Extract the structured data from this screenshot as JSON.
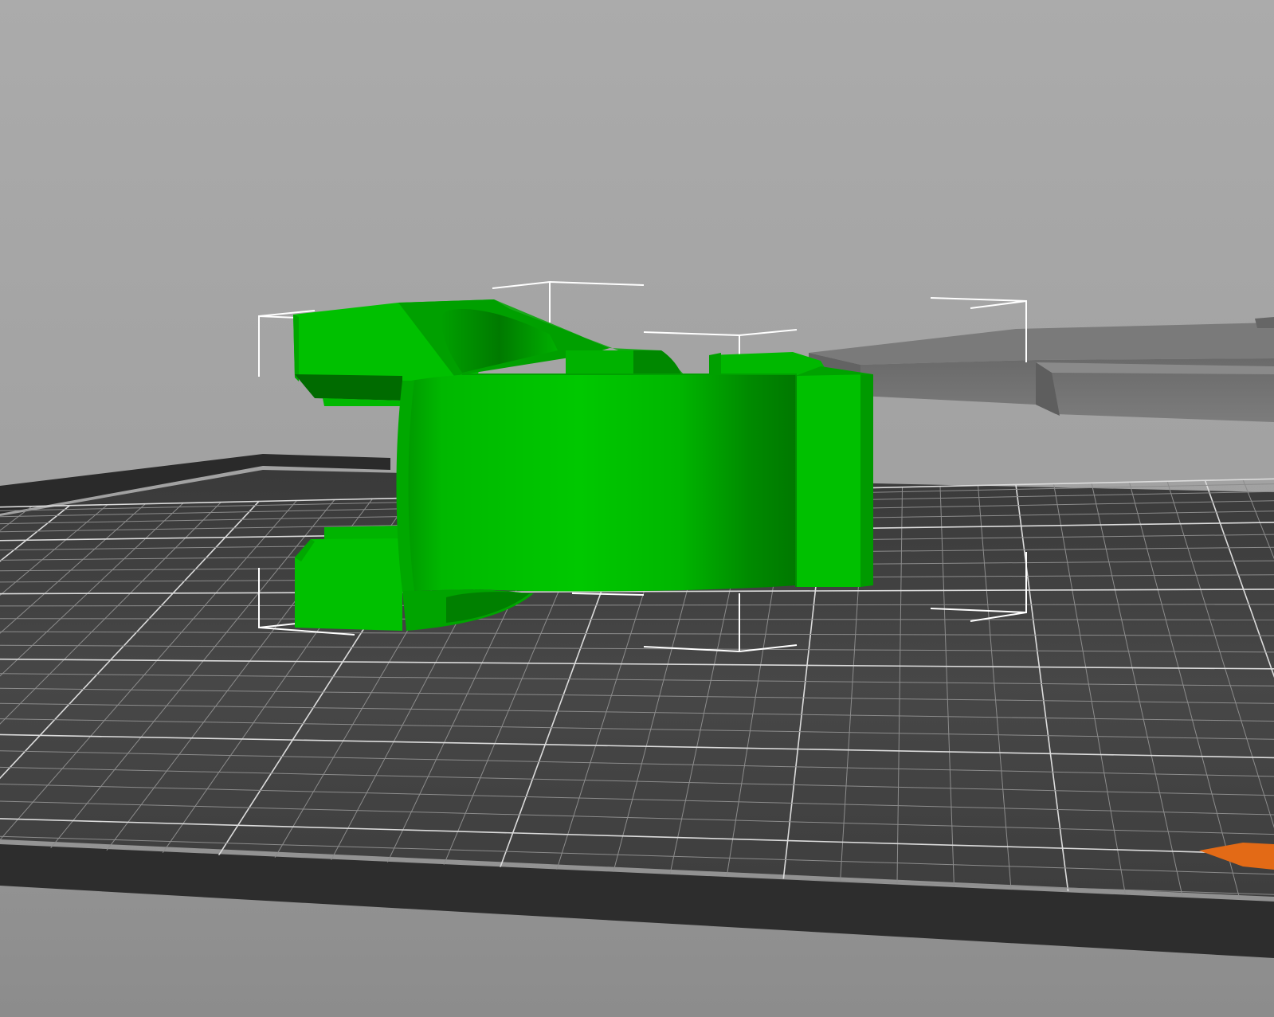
{
  "app": {
    "view": "3d-plater-viewport"
  },
  "scene": {
    "background_top": "#a9a9a9",
    "background_bottom": "#8a8a8a",
    "bed_color": "#404040",
    "bed_edge_color": "#2e2e2e",
    "grid_color": "#8c8c8c",
    "grid_major_color": "#dcdcdc",
    "bed_logo_color": "#e36a16"
  },
  "objects": [
    {
      "name": "selected-model",
      "color": "#00c400",
      "shade_color": "#008f00",
      "highlight_color": "#1fdc1f",
      "selected": true
    },
    {
      "name": "background-model",
      "color": "#6e6e6e",
      "selected": false
    }
  ],
  "selection_box": {
    "color": "#ffffff"
  }
}
